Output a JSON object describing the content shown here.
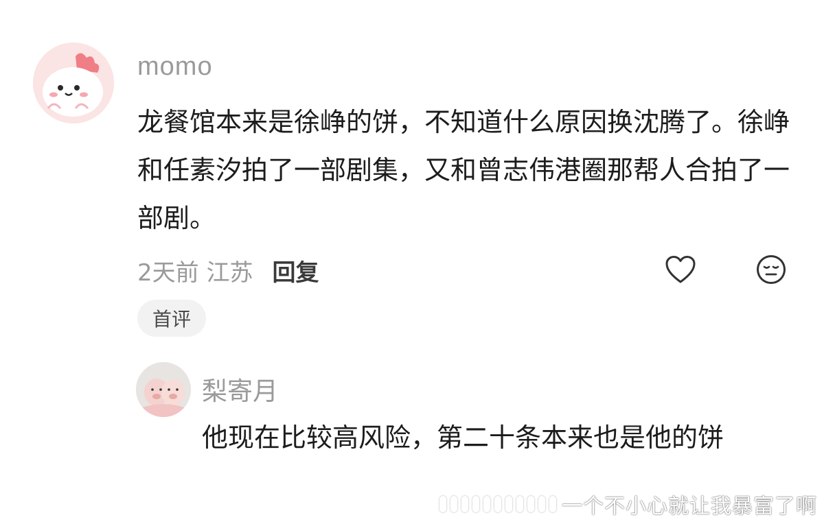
{
  "comment": {
    "username": "momo",
    "text": "龙餐馆本来是徐峥的饼，不知道什么原因换沈腾了。徐峥和任素汐拍了一部剧集，又和曾志伟港圈那帮人合拍了一部剧。",
    "time_location": "2天前 江苏",
    "reply_label": "回复",
    "badge": "首评",
    "like_icon": "heart-outline",
    "dislike_icon": "meh-face"
  },
  "reply": {
    "username": "梨寄月",
    "text": "他现在比较高风险，第二十条本来也是他的饼"
  },
  "watermark": {
    "text": "一个不小心就让我暴富了啊"
  },
  "colors": {
    "muted": "#9a9a9a",
    "text": "#1c1c1c",
    "badge_bg": "#f2f2f2"
  }
}
